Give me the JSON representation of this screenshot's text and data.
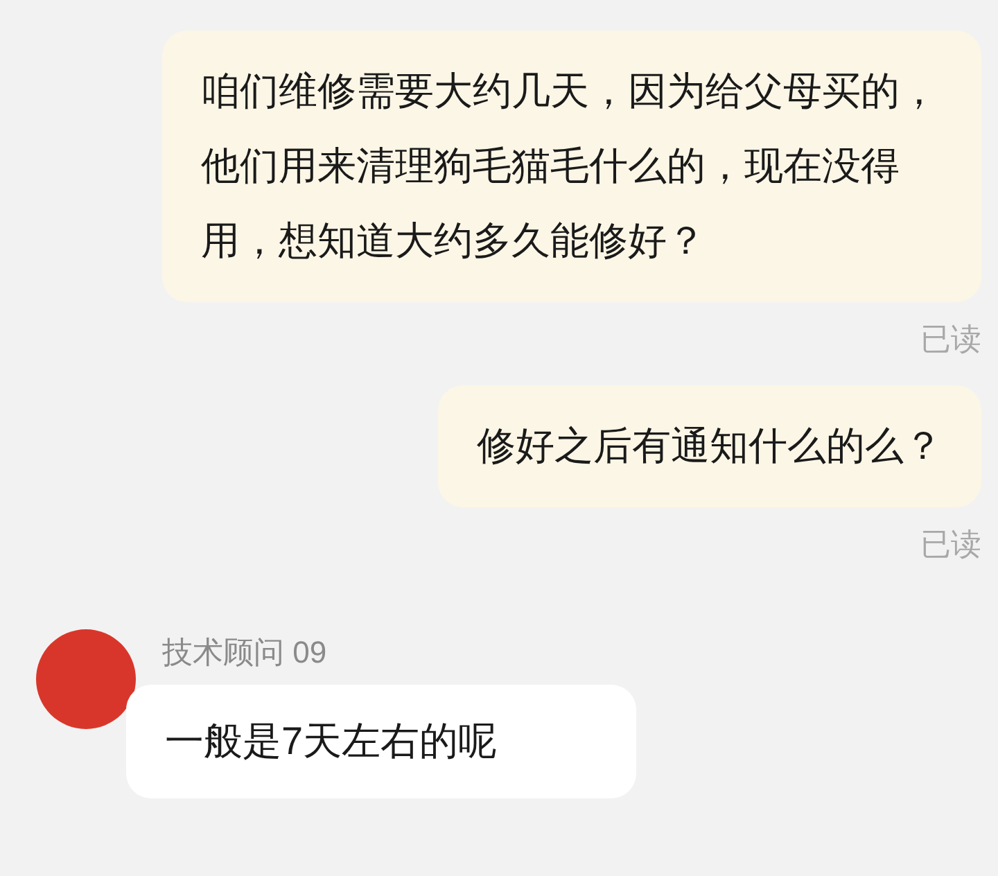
{
  "messages": [
    {
      "kind": "outgoing",
      "text": "咱们维修需要大约几天，因为给父母买的，他们用来清理狗毛猫毛什么的，现在没得用，想知道大约多久能修好？",
      "status": "已读"
    },
    {
      "kind": "outgoing",
      "text": "修好之后有通知什么的么？",
      "status": "已读"
    },
    {
      "kind": "incoming",
      "sender": "技术顾问 09",
      "text": "一般是7天左右的呢"
    }
  ]
}
